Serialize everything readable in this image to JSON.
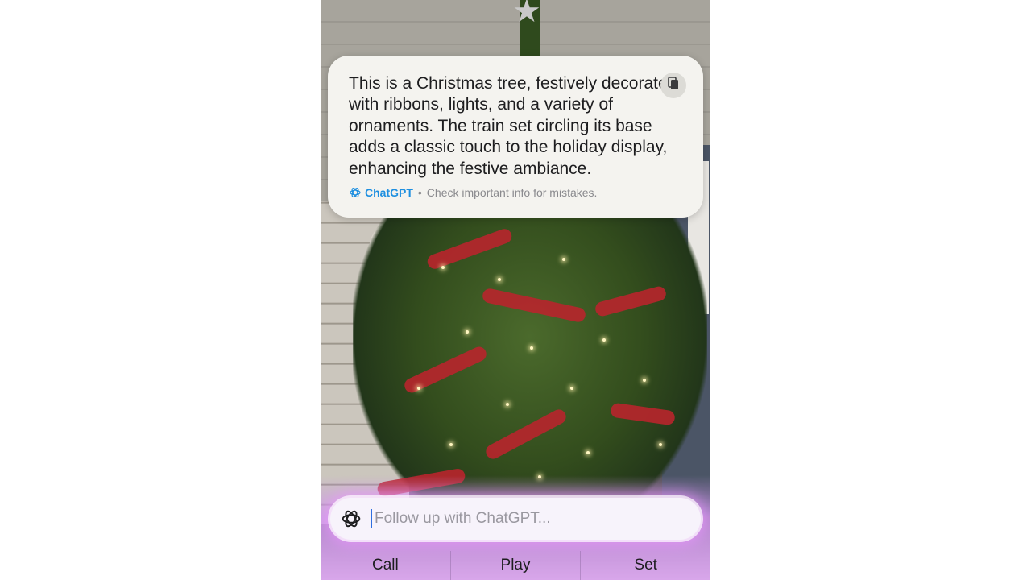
{
  "response": {
    "text": "This is a Christmas tree, festively decorated with ribbons, lights, and a variety of ornaments. The train set circling its base adds a classic touch to the holiday display, enhancing the festive ambiance.",
    "source_name": "ChatGPT",
    "separator": "•",
    "disclaimer": "Check important info for mistakes.",
    "copy_icon": "copy-icon"
  },
  "followup": {
    "placeholder": "Follow up with ChatGPT...",
    "value": "",
    "logo_icon": "chatgpt-logo-icon"
  },
  "suggestions": [
    "Call",
    "Play",
    "Set"
  ],
  "colors": {
    "accent": "#1e8fe0",
    "card_bg": "#f4f3ef",
    "glow": "#d8a6ea"
  }
}
